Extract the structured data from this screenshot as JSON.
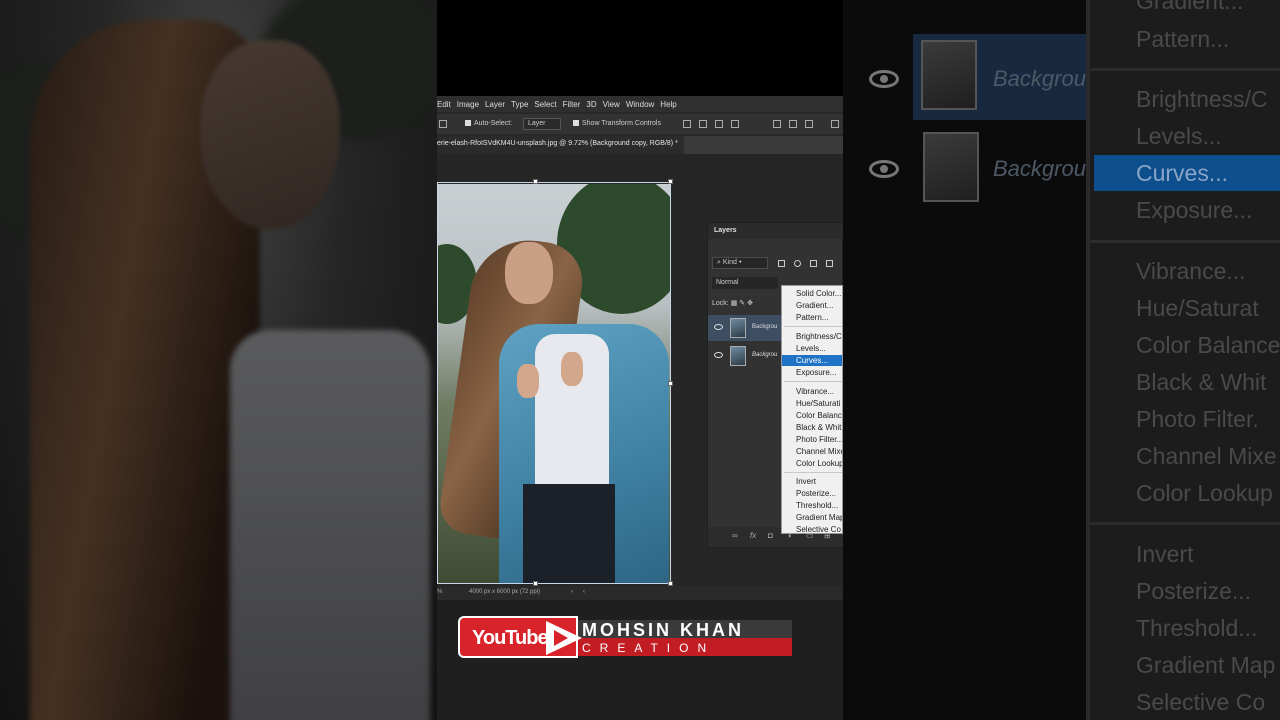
{
  "app": {
    "menu": [
      "Edit",
      "Image",
      "Layer",
      "Type",
      "Select",
      "Filter",
      "3D",
      "View",
      "Window",
      "Help"
    ],
    "options": {
      "auto_select_label": "Auto-Select:",
      "auto_select_value": "Layer",
      "show_transform_label": "Show Transform Controls"
    },
    "doc_tab": "erie-elash-RfoISVdKM4U-unsplash.jpg @ 9.72% (Background copy, RGB/8) *",
    "status": {
      "zoom": "%",
      "doc_info": "4000 px x 6000 px (72 ppi)"
    }
  },
  "layers_panel": {
    "title": "Layers",
    "kind_filter": "Kind",
    "blend_mode": "Normal",
    "lock_label": "Lock:",
    "layers": [
      {
        "name": "Backgrou",
        "active": true
      },
      {
        "name": "Backgrou",
        "active": false
      }
    ],
    "footer_fx": "fx"
  },
  "adjustment_menu": {
    "groups": [
      [
        "Solid Color...",
        "Gradient...",
        "Pattern..."
      ],
      [
        "Brightness/C",
        "Levels...",
        "Curves...",
        "Exposure..."
      ],
      [
        "Vibrance...",
        "Hue/Saturati",
        "Color Balanc",
        "Black & Whit",
        "Photo Filter...",
        "Channel Mixe",
        "Color Lookup"
      ],
      [
        "Invert",
        "Posterize...",
        "Threshold...",
        "Gradient Map",
        "Selective Co"
      ]
    ],
    "highlighted": "Curves..."
  },
  "zoomed_menu": {
    "items": [
      "Gradient...",
      "Pattern...",
      "Brightness/C",
      "Levels...",
      "Curves...",
      "Exposure...",
      "Vibrance...",
      "Hue/Saturat",
      "Color Balance",
      "Black & Whit",
      "Photo Filter.",
      "Channel Mixe",
      "Color Lookup",
      "Invert",
      "Posterize...",
      "Threshold...",
      "Gradient Map",
      "Selective Co"
    ],
    "layer_name": "Backgrou"
  },
  "watermark": {
    "logo": "YouTube",
    "name": "MOHSIN KHAN",
    "sub": "CREATION"
  },
  "colors": {
    "menu_highlight": "#1f73c6",
    "active_layer": "#3d4e63",
    "brand_red": "#d8232a"
  }
}
